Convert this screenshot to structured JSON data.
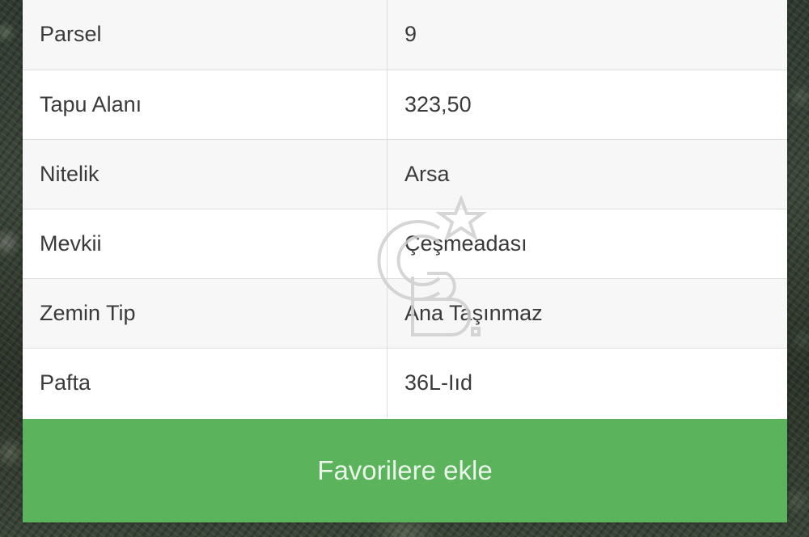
{
  "rows": [
    {
      "label": "Parsel",
      "value": "9"
    },
    {
      "label": "Tapu Alanı",
      "value": "323,50"
    },
    {
      "label": "Nitelik",
      "value": "Arsa"
    },
    {
      "label": "Mevkii",
      "value": "Çeşmeadası"
    },
    {
      "label": "Zemin Tip",
      "value": "Ana Taşınmaz"
    },
    {
      "label": "Pafta",
      "value": "36L-Iıd"
    }
  ],
  "favorite_button": {
    "label": "Favorilere ekle"
  },
  "watermark": {
    "icon": "cb-star-logo"
  },
  "colors": {
    "button": "#5bb35b",
    "button_text": "#eaf6ea",
    "row_alt": "#f7f7f7"
  }
}
